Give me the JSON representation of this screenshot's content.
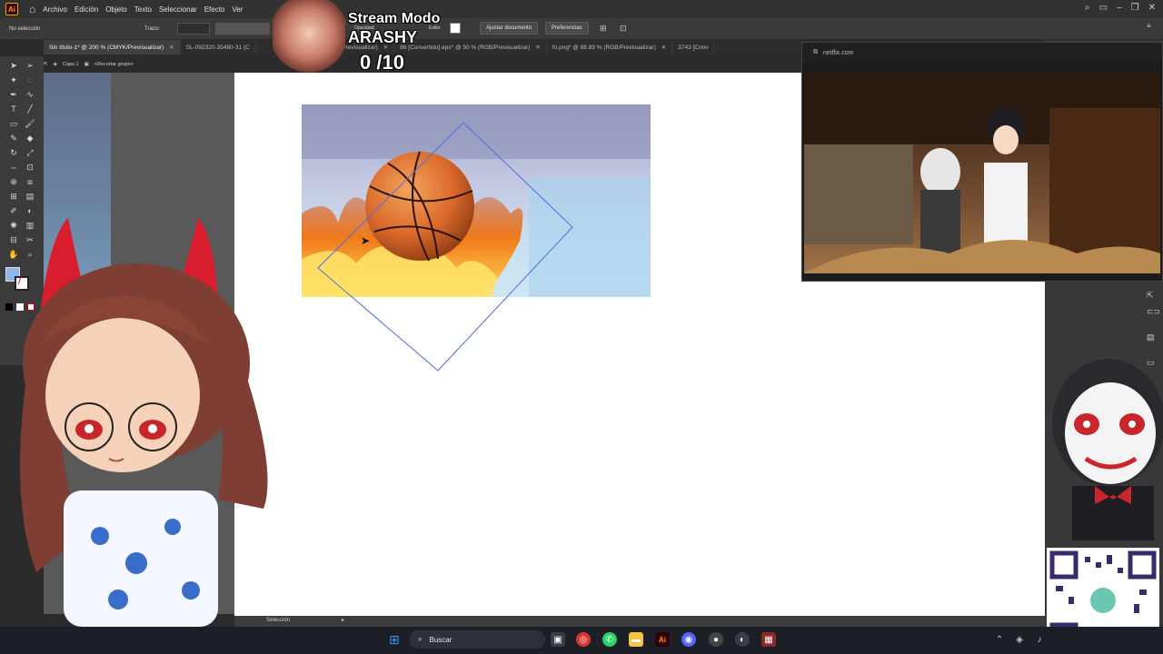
{
  "app": {
    "logo": "Ai",
    "menus": [
      "Archivo",
      "Edición",
      "Objeto",
      "Texto",
      "Seleccionar",
      "Efecto",
      "Ver"
    ]
  },
  "controlbar": {
    "selection_label": "No selección",
    "stroke_label": "Trazo:",
    "opacity_label": "Opacidad:",
    "style_label": "Estilo:",
    "fit_button": "Ajustar documento",
    "prefs_button": "Preferencias"
  },
  "tabs": [
    {
      "label": "Sin título-1* @ 200 % (CMYK/Previsualizar)",
      "active": true
    },
    {
      "label": "SL-092320-35480-31 (C",
      "active": false
    },
    {
      "label": "00 % (RGB/Previsualizar)",
      "active": false
    },
    {
      "label": "86 [Convertido].eps* @ 50 % (RGB/Previsualizar)",
      "active": false
    },
    {
      "label": "fo.png* @ 88.89 % (RGB/Previsualizar)",
      "active": false
    },
    {
      "label": "3743 [Conv",
      "active": false
    }
  ],
  "breadcrumb": {
    "layer": "Capa 1",
    "group": "<Recortar grupo>"
  },
  "status": {
    "tool": "Selección"
  },
  "stream": {
    "title": "Stream Modo",
    "name": "ARASHY",
    "count": "0 /10"
  },
  "pip": {
    "domain": "netflix.com"
  },
  "taskbar": {
    "search_label": "Buscar"
  },
  "colors": {
    "accent": "#3d8af7",
    "menubar": "#323232",
    "canvas": "#ffffff"
  },
  "icons": [
    "home-icon",
    "selection-tool-icon",
    "pen-tool-icon",
    "type-tool-icon",
    "rectangle-tool-icon",
    "brush-tool-icon",
    "hand-tool-icon",
    "zoom-tool-icon",
    "search-icon",
    "windows-start-icon",
    "chrome-icon",
    "explorer-icon",
    "illustrator-icon",
    "discord-icon"
  ]
}
